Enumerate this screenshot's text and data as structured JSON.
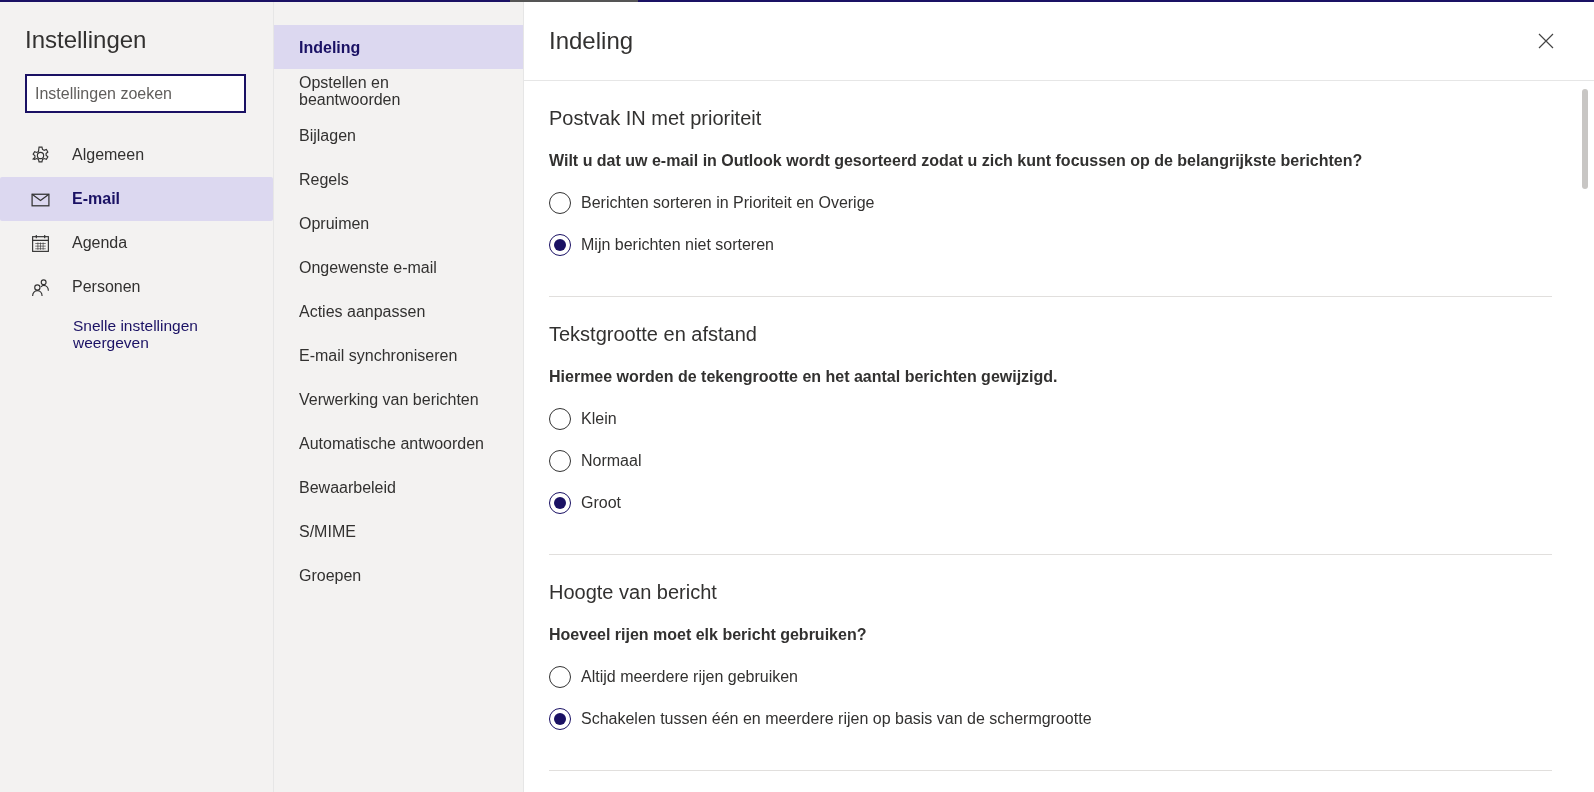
{
  "sidebar": {
    "title": "Instellingen",
    "search": {
      "placeholder": "Instellingen zoeken"
    },
    "items": [
      {
        "label": "Algemeen",
        "selected": false
      },
      {
        "label": "E-mail",
        "selected": true
      },
      {
        "label": "Agenda",
        "selected": false
      },
      {
        "label": "Personen",
        "selected": false
      }
    ],
    "link": "Snelle instellingen weergeven"
  },
  "subnav": {
    "items": [
      {
        "label": "Indeling",
        "selected": true
      },
      {
        "label": "Opstellen en beantwoorden",
        "selected": false
      },
      {
        "label": "Bijlagen",
        "selected": false
      },
      {
        "label": "Regels",
        "selected": false
      },
      {
        "label": "Opruimen",
        "selected": false
      },
      {
        "label": "Ongewenste e-mail",
        "selected": false
      },
      {
        "label": "Acties aanpassen",
        "selected": false
      },
      {
        "label": "E-mail synchroniseren",
        "selected": false
      },
      {
        "label": "Verwerking van berichten",
        "selected": false
      },
      {
        "label": "Automatische antwoorden",
        "selected": false
      },
      {
        "label": "Bewaarbeleid",
        "selected": false
      },
      {
        "label": "S/MIME",
        "selected": false
      },
      {
        "label": "Groepen",
        "selected": false
      }
    ]
  },
  "panel": {
    "title": "Indeling",
    "sections": [
      {
        "title": "Postvak IN met prioriteit",
        "question": "Wilt u dat uw e-mail in Outlook wordt gesorteerd zodat u zich kunt focussen op de belangrijkste berichten?",
        "options": [
          {
            "label": "Berichten sorteren in Prioriteit en Overige",
            "selected": false
          },
          {
            "label": "Mijn berichten niet sorteren",
            "selected": true
          }
        ]
      },
      {
        "title": "Tekstgrootte en afstand",
        "question": "Hiermee worden de tekengrootte en het aantal berichten gewijzigd.",
        "options": [
          {
            "label": "Klein",
            "selected": false
          },
          {
            "label": "Normaal",
            "selected": false
          },
          {
            "label": "Groot",
            "selected": true
          }
        ]
      },
      {
        "title": "Hoogte van bericht",
        "question": "Hoeveel rijen moet elk bericht gebruiken?",
        "options": [
          {
            "label": "Altijd meerdere rijen gebruiken",
            "selected": false
          },
          {
            "label": "Schakelen tussen één en meerdere rijen op basis van de schermgrootte",
            "selected": true
          }
        ]
      }
    ]
  }
}
